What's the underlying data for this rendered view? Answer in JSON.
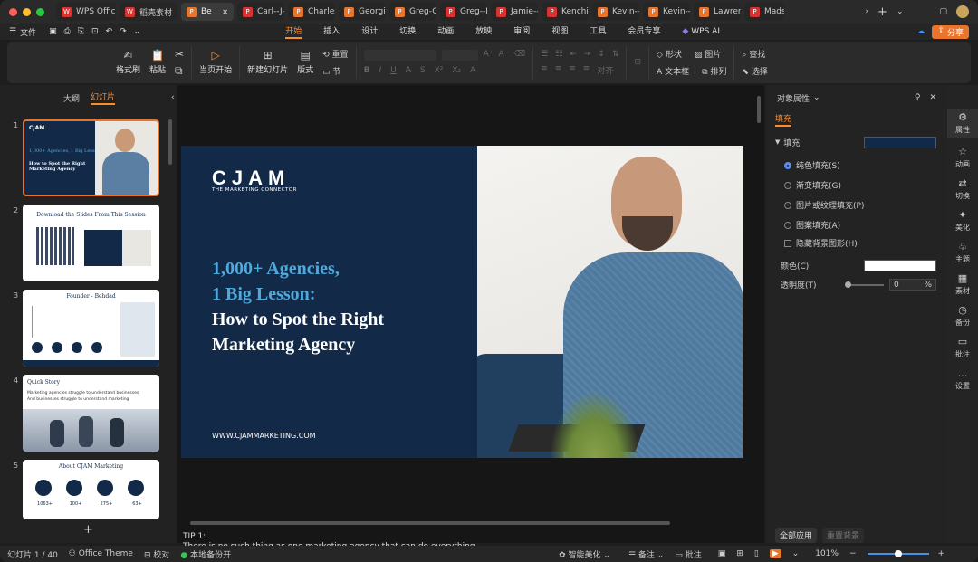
{
  "window": {
    "tabs": [
      {
        "label": "WPS Office",
        "icon": "wps-logo-icon",
        "color": "#d9322f"
      },
      {
        "label": "稻壳素材",
        "icon": "docer-icon",
        "color": "#d9322f"
      },
      {
        "label": "Be",
        "icon": "presentation-icon",
        "color": "#e8752b",
        "active": true
      },
      {
        "label": "Carl--J--B",
        "icon": "presentation-icon",
        "color": "#d9322f"
      },
      {
        "label": "Charles--",
        "icon": "presentation-icon",
        "color": "#e8752b"
      },
      {
        "label": "Georgia--",
        "icon": "presentation-icon",
        "color": "#e8752b"
      },
      {
        "label": "Greg-Git",
        "icon": "presentation-icon",
        "color": "#e8752b"
      },
      {
        "label": "Greg--He",
        "icon": "presentation-icon",
        "color": "#d9322f"
      },
      {
        "label": "Jamie--IF",
        "icon": "presentation-icon",
        "color": "#d9322f"
      },
      {
        "label": "Kenchi--S",
        "icon": "presentation-icon",
        "color": "#d9322f"
      },
      {
        "label": "Kevin--Je",
        "icon": "presentation-icon",
        "color": "#e8752b"
      },
      {
        "label": "Kevin--M",
        "icon": "presentation-icon",
        "color": "#e8752b"
      },
      {
        "label": "Lawrence",
        "icon": "presentation-icon",
        "color": "#e8752b"
      },
      {
        "label": "Mads--",
        "icon": "presentation-icon",
        "color": "#d9322f"
      }
    ]
  },
  "menu": {
    "file": "文件",
    "items": [
      "开始",
      "插入",
      "设计",
      "切换",
      "动画",
      "放映",
      "审阅",
      "视图",
      "工具",
      "会员专享"
    ],
    "active": "开始",
    "wps_ai": "WPS AI",
    "share": "分享"
  },
  "ribbon": {
    "format_painter": "格式刷",
    "paste": "粘贴",
    "play_from_current": "当页开始",
    "new_slide": "新建幻灯片",
    "layout": "版式",
    "reset": "重置",
    "section": "节",
    "arrange_text": "对齐",
    "shape": "形状",
    "picture": "图片",
    "textbox": "文本框",
    "arrange": "排列",
    "find": "查找",
    "select": "选择"
  },
  "left_panel": {
    "tab_outline": "大纲",
    "tab_slides": "幻灯片",
    "slides": [
      {
        "num": "1",
        "title": "1,000+ Agencies, 1 Big Lesson:",
        "subtitle": "How to Spot the Right Marketing Agency"
      },
      {
        "num": "2",
        "title": "Download the Slides From This Session"
      },
      {
        "num": "3",
        "title": "Founder - Behdad"
      },
      {
        "num": "4",
        "title": "Quick Story",
        "line1": "Marketing agencies struggle to understand businesses",
        "line2": "And businesses struggle to understand marketing"
      },
      {
        "num": "5",
        "title": "About CJAM Marketing",
        "stats": [
          "1063+",
          "100+",
          "275+",
          "63+"
        ]
      }
    ],
    "add_label": "+"
  },
  "slide": {
    "logo": "CJAM",
    "tagline": "THE MARKETING CONNECTOR",
    "headline_line1": "1,000+ Agencies,",
    "headline_line2": "1 Big Lesson:",
    "headline_line3": "How to Spot the Right",
    "headline_line4": "Marketing Agency",
    "url": "WWW.CJAMMARKETING.COM",
    "colors": {
      "navy": "#122a48",
      "accent": "#4fa9dd"
    }
  },
  "notes": {
    "line1": "TIP 1:",
    "line2": "There is no such thing as one marketing agency that can do everything"
  },
  "right_panel": {
    "title": "对象属性",
    "tab": "填充",
    "section": "填充",
    "options": [
      "纯色填充(S)",
      "渐变填充(G)",
      "图片或纹理填充(P)",
      "图案填充(A)"
    ],
    "hide_bg": "隐藏背景图形(H)",
    "color_label": "颜色(C)",
    "transparency_label": "透明度(T)",
    "transparency_value": "0",
    "transparency_unit": "%",
    "apply_all": "全部应用",
    "reset_bg": "重置背景"
  },
  "side_bar": [
    "属性",
    "动画",
    "切换",
    "美化",
    "主题",
    "素材",
    "备份",
    "批注",
    "设置"
  ],
  "status": {
    "slide_count": "幻灯片 1 / 40",
    "theme": "Office Theme",
    "proofread": "校对",
    "backup": "本地备份开",
    "smart_beautify": "智能美化",
    "notes": "备注",
    "comments": "批注",
    "zoom": "101%"
  }
}
